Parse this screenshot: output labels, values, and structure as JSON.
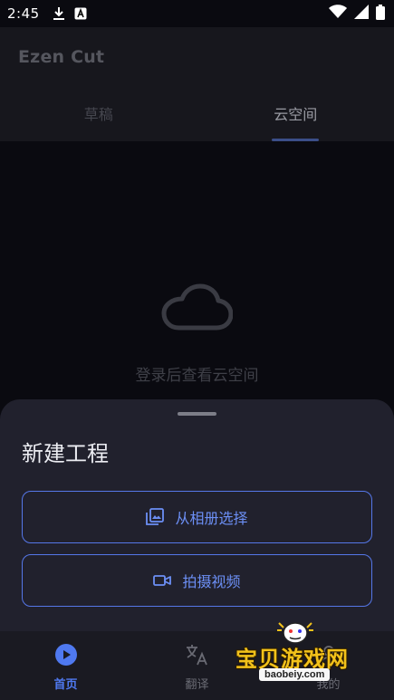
{
  "status_bar": {
    "time": "2:45",
    "icons": [
      "download-icon",
      "app-notification-icon",
      "wifi-icon",
      "signal-icon",
      "battery-icon"
    ]
  },
  "app": {
    "title": "Ezen Cut"
  },
  "tabs": [
    {
      "label": "草稿",
      "active": false
    },
    {
      "label": "云空间",
      "active": true
    }
  ],
  "empty_state": {
    "icon": "cloud-icon",
    "text": "登录后查看云空间"
  },
  "sheet": {
    "title": "新建工程",
    "buttons": [
      {
        "label": "从相册选择",
        "icon": "gallery-icon"
      },
      {
        "label": "拍摄视频",
        "icon": "videocam-icon"
      }
    ]
  },
  "bottom_nav": [
    {
      "label": "首页",
      "icon": "play-circle-icon",
      "active": true
    },
    {
      "label": "翻译",
      "icon": "translate-icon",
      "active": false
    },
    {
      "label": "我的",
      "icon": "profile-icon",
      "active": false
    }
  ],
  "watermark": {
    "title": "宝贝游戏网",
    "domain": "baobeiy.com"
  },
  "colors": {
    "accent": "#4f79f0",
    "background": "#0a0a10",
    "sheet": "#21212d"
  }
}
